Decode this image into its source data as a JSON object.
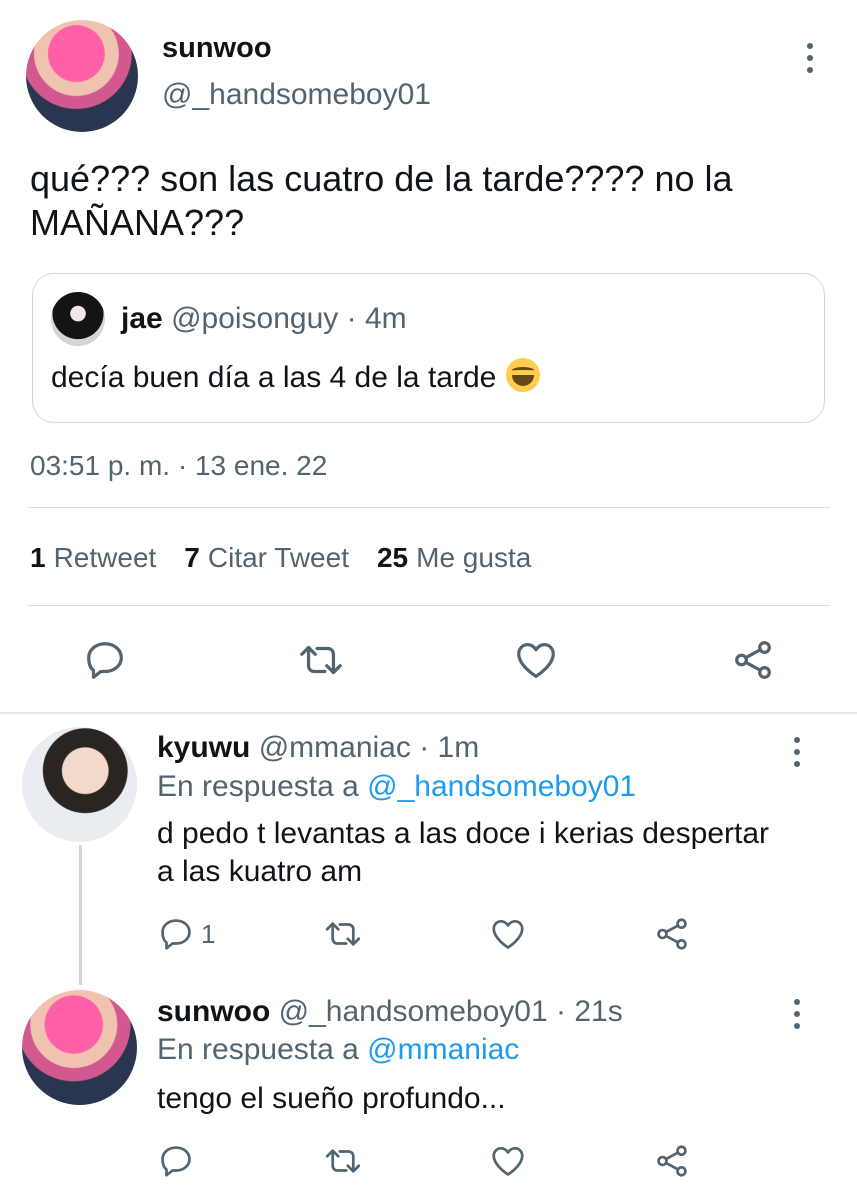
{
  "main_tweet": {
    "name": "sunwoo",
    "handle": "@_handsomeboy01",
    "text_line1": "qué??? son las cuatro de la tarde???? no la",
    "text_line2": "MAÑANA???",
    "quote": {
      "name": "jae",
      "handle": "@poisonguy",
      "sep": "·",
      "time": "4m",
      "text": "decía buen día a las 4 de la tarde"
    },
    "timestamp": "03:51 p. m. · 13 ene. 22",
    "stats": {
      "retweets_count": "1",
      "retweets_label": "Retweet",
      "quotes_count": "7",
      "quotes_label": "Citar Tweet",
      "likes_count": "25",
      "likes_label": "Me gusta"
    }
  },
  "replies": [
    {
      "name": "kyuwu",
      "handle": "@mmaniac",
      "sep": "·",
      "time": "1m",
      "reply_prefix": "En respuesta a",
      "reply_to": "@_handsomeboy01",
      "text_line1": "d pedo t levantas a las doce i kerias despertar",
      "text_line2": "a las kuatro am",
      "reply_count": "1"
    },
    {
      "name": "sunwoo",
      "handle": "@_handsomeboy01",
      "sep": "·",
      "time": "21s",
      "reply_prefix": "En respuesta a",
      "reply_to": "@mmaniac",
      "text_line1": "tengo el sueño profundo..."
    }
  ],
  "icons": [
    "reply-icon",
    "retweet-icon",
    "like-icon",
    "share-icon",
    "more-icon",
    "emoji-laughing"
  ],
  "colors": {
    "accent": "#1d9bf0",
    "secondary_text": "#536471",
    "text": "#0f1419",
    "border": "#cfd9de"
  }
}
